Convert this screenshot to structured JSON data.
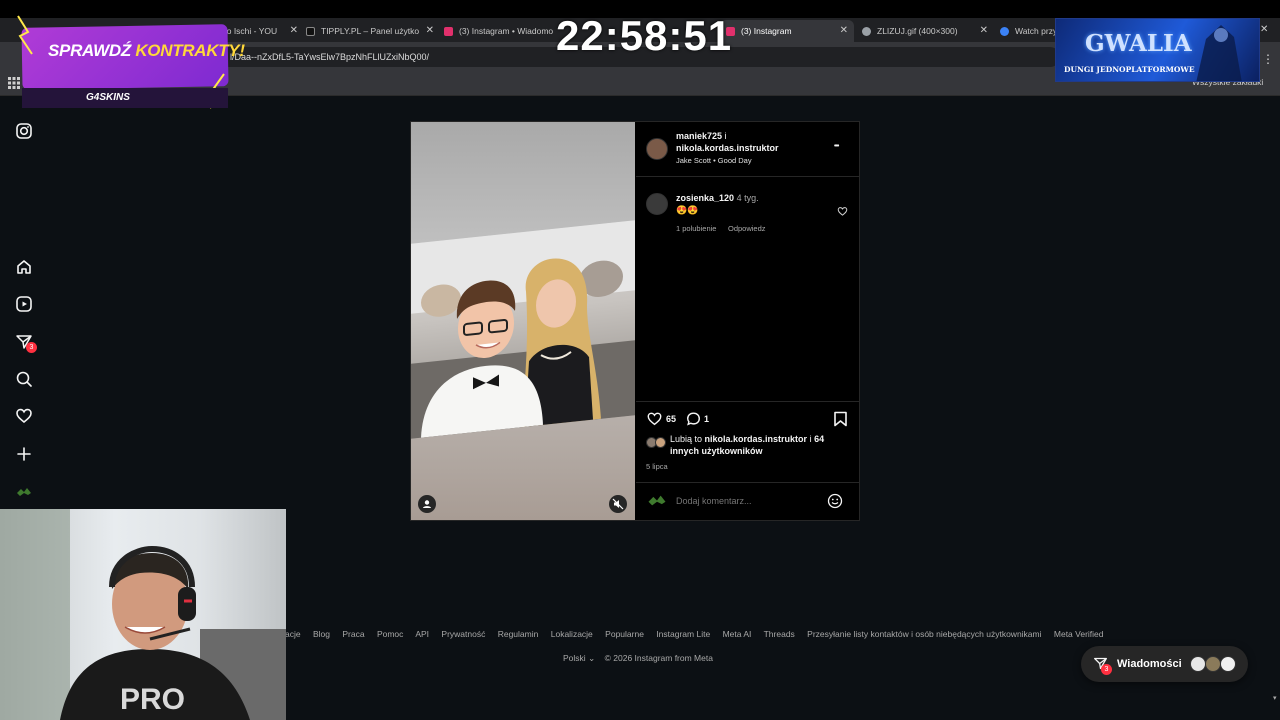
{
  "browser": {
    "tabs": [
      {
        "title": "eo Ischi - YOU",
        "favicon_color": "#ff0000",
        "active": false
      },
      {
        "title": "TIPPLY.PL – Panel użytkow",
        "favicon_color": "#ffffff",
        "active": false
      },
      {
        "title": "(3) Instagram • Wiadomo",
        "favicon_color": "#e1306c",
        "active": false
      },
      {
        "title": "(3) Instagram",
        "favicon_color": "#e1306c",
        "active": true
      },
      {
        "title": "ZLIZUJ.gif (400×300)",
        "favicon_color": "#9aa0a6",
        "active": false
      },
      {
        "title": "Watch przy",
        "favicon_color": "#3b82f6",
        "active": false
      }
    ],
    "url": "l/Daa--nZxDfL5-TaYwsElw7BpzNhFLlUZxiNbQ00/",
    "bookmarks_all": "Wszystkie zakładki"
  },
  "overlay": {
    "clock": "22:58:51",
    "promo": {
      "text_a": "SPRAWDŹ ",
      "text_b": "KONTRAKTY!",
      "brand": "G4SKINS"
    },
    "gwalia": {
      "title": "GWALIA",
      "subtitle": "DUNGI JEDNOPLATFORMOWE"
    }
  },
  "nav": {
    "notifications_count": "3"
  },
  "post": {
    "author_line1": "maniek725",
    "author_and": " i",
    "author_line2": "nikola.kordas.instruktor",
    "audio": "Jake Scott • Good Day",
    "more": "•••",
    "comment": {
      "user": "zosienka_120",
      "age": "4 tyg.",
      "text": "😍😍",
      "likes": "1 polubienie",
      "reply": "Odpowiedz"
    },
    "like_count": "65",
    "comment_count": "1",
    "liked_by_prefix": "Lubią to ",
    "liked_by_user": "nikola.kordas.instruktor",
    "liked_by_mid": " i ",
    "liked_by_rest": "64",
    "liked_by_suffix": "innych użytkowników",
    "date": "5 lipca",
    "add_comment_placeholder": "Dodaj komentarz..."
  },
  "footer": {
    "links": [
      "acje",
      "Blog",
      "Praca",
      "Pomoc",
      "API",
      "Prywatność",
      "Regulamin",
      "Lokalizacje",
      "Popularne",
      "Instagram Lite",
      "Meta AI",
      "Threads",
      "Przesyłanie listy kontaktów i osób niebędących użytkownikami",
      "Meta Verified"
    ],
    "language": "Polski",
    "copyright": "© 2026 Instagram from Meta"
  },
  "messages": {
    "label": "Wiadomości",
    "count": "3"
  },
  "colors": {
    "badge": "#ff3040",
    "background": "#0c1014"
  }
}
